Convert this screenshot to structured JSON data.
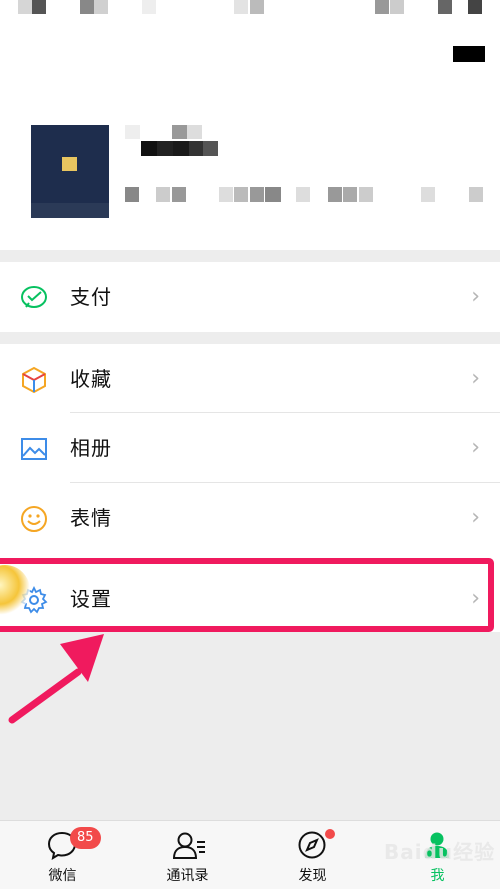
{
  "menu": {
    "pay_label": "支付",
    "favorites_label": "收藏",
    "album_label": "相册",
    "stickers_label": "表情",
    "settings_label": "设置",
    "chevron": "›"
  },
  "tabbar": {
    "chats_label": "微信",
    "chats_badge": "85",
    "contacts_label": "通讯录",
    "discover_label": "发现",
    "me_label": "我"
  },
  "watermark": "Baidu经验",
  "colors": {
    "accent_green": "#07c160",
    "highlight": "#f01a5e",
    "badge": "#f24a4a"
  }
}
